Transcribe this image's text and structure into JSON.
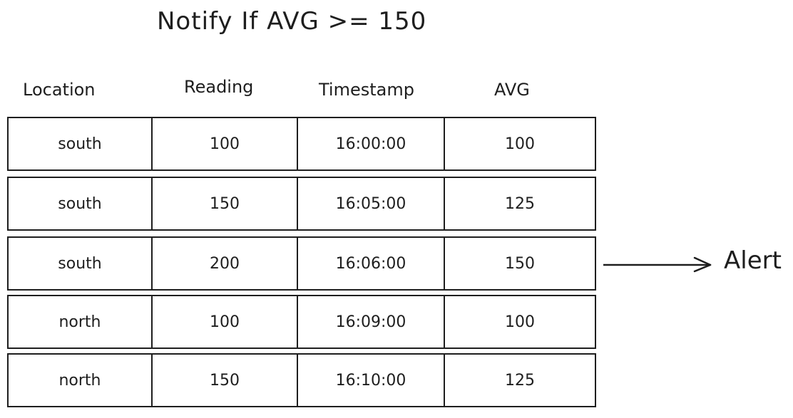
{
  "title": "Notify If AVG >= 150",
  "table": {
    "headers": [
      "Location",
      "Reading",
      "Timestamp",
      "AVG"
    ],
    "rows": [
      {
        "location": "south",
        "reading": "100",
        "timestamp": "16:00:00",
        "avg": "100"
      },
      {
        "location": "south",
        "reading": "150",
        "timestamp": "16:05:00",
        "avg": "125"
      },
      {
        "location": "south",
        "reading": "200",
        "timestamp": "16:06:00",
        "avg": "150"
      },
      {
        "location": "north",
        "reading": "100",
        "timestamp": "16:09:00",
        "avg": "100"
      },
      {
        "location": "north",
        "reading": "150",
        "timestamp": "16:10:00",
        "avg": "125"
      }
    ]
  },
  "alert": {
    "label": "Alert",
    "row_index": 2
  },
  "colors": {
    "stroke": "#1e1e1e",
    "background": "#ffffff"
  }
}
